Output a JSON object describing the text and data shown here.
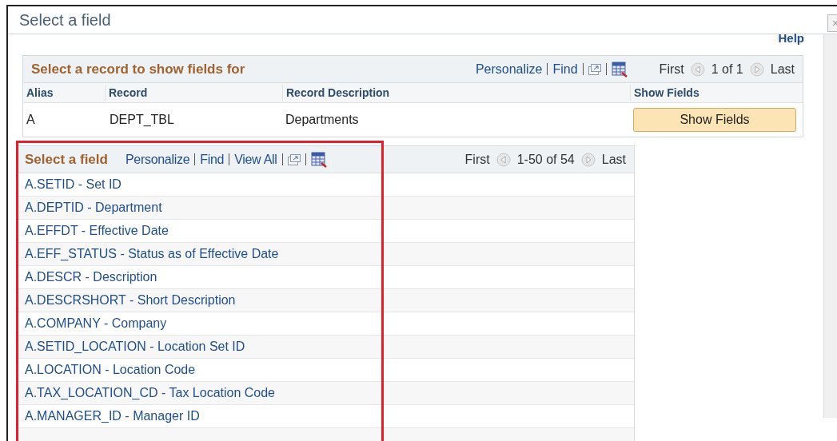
{
  "window": {
    "title": "Select a field",
    "close": "×"
  },
  "help": "Help",
  "record_grid": {
    "title": "Select a record to show fields for",
    "links": [
      "Personalize",
      "Find"
    ],
    "nav": {
      "first": "First",
      "range": "1 of 1",
      "last": "Last"
    },
    "columns": [
      "Alias",
      "Record",
      "Record Description",
      "Show Fields"
    ],
    "rows": [
      {
        "alias": "A",
        "record": "DEPT_TBL",
        "description": "Departments",
        "button": "Show Fields"
      }
    ]
  },
  "field_grid": {
    "title": "Select a field",
    "highlighted": true,
    "links": [
      "Personalize",
      "Find",
      "View All"
    ],
    "nav": {
      "first": "First",
      "range": "1-50 of 54",
      "last": "Last"
    },
    "rows": [
      "A.SETID - Set ID",
      "A.DEPTID - Department",
      "A.EFFDT - Effective Date",
      "A.EFF_STATUS - Status as of Effective Date",
      "A.DESCR - Description",
      "A.DESCRSHORT - Short Description",
      "A.COMPANY - Company",
      "A.SETID_LOCATION - Location Set ID",
      "A.LOCATION - Location Code",
      "A.TAX_LOCATION_CD - Tax Location Code",
      "A.MANAGER_ID - Manager ID"
    ]
  }
}
